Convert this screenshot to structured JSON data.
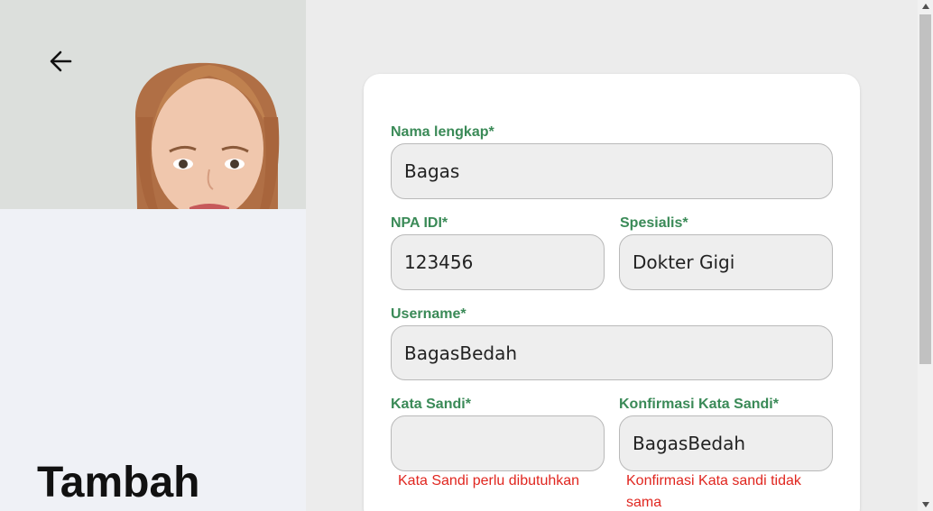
{
  "header": {
    "back_icon": "arrow-left-icon",
    "title": "Tambah"
  },
  "photo": {
    "description_icon": "doctor-portrait-photo"
  },
  "form": {
    "full_name": {
      "label": "Nama lengkap*",
      "value": "Bagas"
    },
    "npa_idi": {
      "label": "NPA IDI*",
      "value": "123456"
    },
    "specialist": {
      "label": "Spesialis*",
      "value": "Dokter Gigi"
    },
    "username": {
      "label": "Username*",
      "value": "BagasBedah"
    },
    "password": {
      "label": "Kata Sandi*",
      "value": "",
      "error": "Kata Sandi perlu dibutuhkan"
    },
    "confirm_password": {
      "label": "Konfirmasi Kata Sandi*",
      "value": "BagasBedah",
      "error_line1": "Konfirmasi Kata sandi tidak",
      "error_line2": "sama"
    }
  },
  "colors": {
    "label_green": "#3a8a57",
    "error_red": "#e0261f",
    "card_bg": "#ffffff",
    "left_panel_bg": "#eff1f6"
  },
  "scrollbar": {
    "up_icon": "triangle-up-icon",
    "down_icon": "triangle-down-icon"
  }
}
